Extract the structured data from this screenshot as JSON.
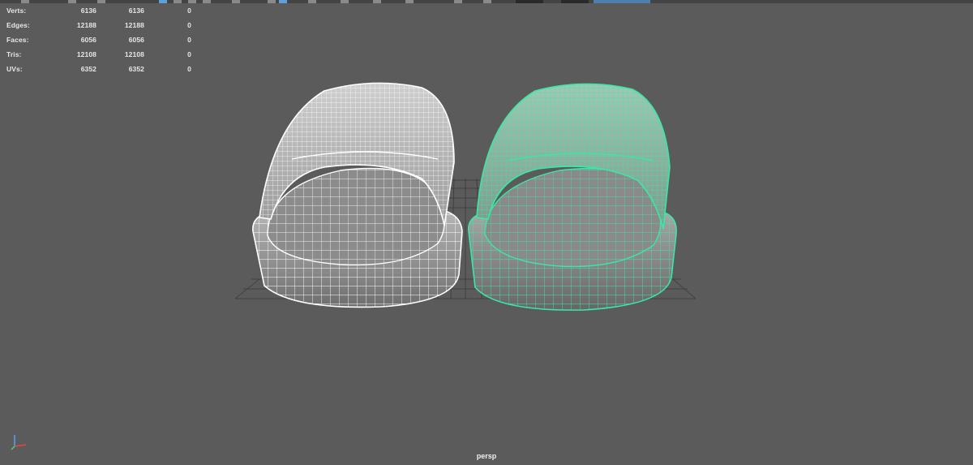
{
  "hud": {
    "rows": [
      {
        "label": "Verts:",
        "v1": "6136",
        "v2": "6136",
        "v3": "0"
      },
      {
        "label": "Edges:",
        "v1": "12188",
        "v2": "12188",
        "v3": "0"
      },
      {
        "label": "Faces:",
        "v1": "6056",
        "v2": "6056",
        "v3": "0"
      },
      {
        "label": "Tris:",
        "v1": "12108",
        "v2": "12108",
        "v3": "0"
      },
      {
        "label": "UVs:",
        "v1": "6352",
        "v2": "6352",
        "v3": "0"
      }
    ]
  },
  "viewport": {
    "camera": "persp",
    "colors": {
      "background": "#5b5b5b",
      "wireframe": "#ffffff",
      "selected_wireframe": "#3be7a6",
      "grid": "#3c3c3c",
      "mesh_fill": "#9a9a9a"
    }
  },
  "icons": [
    "view-axis-icon",
    "grid-icon"
  ]
}
